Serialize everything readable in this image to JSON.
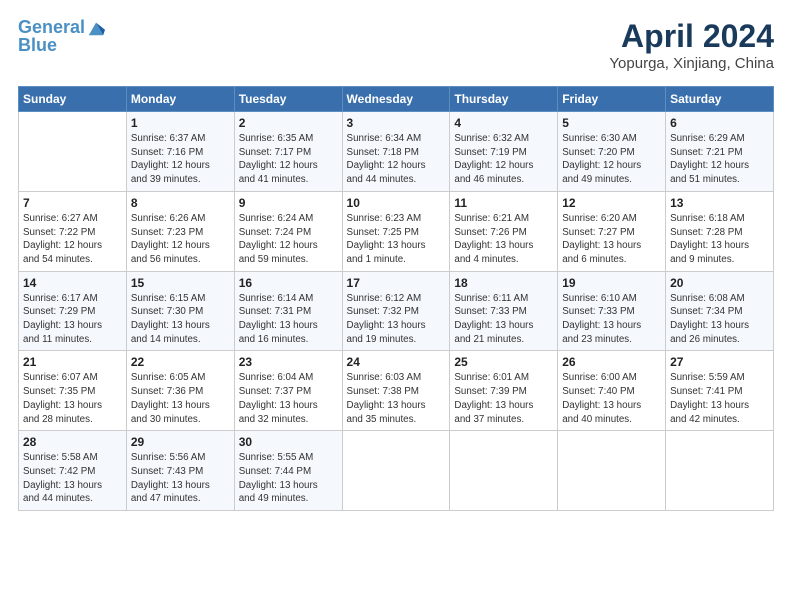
{
  "header": {
    "logo_line1": "General",
    "logo_line2": "Blue",
    "title": "April 2024",
    "subtitle": "Yopurga, Xinjiang, China"
  },
  "columns": [
    "Sunday",
    "Monday",
    "Tuesday",
    "Wednesday",
    "Thursday",
    "Friday",
    "Saturday"
  ],
  "weeks": [
    [
      {
        "day": "",
        "detail": ""
      },
      {
        "day": "1",
        "detail": "Sunrise: 6:37 AM\nSunset: 7:16 PM\nDaylight: 12 hours\nand 39 minutes."
      },
      {
        "day": "2",
        "detail": "Sunrise: 6:35 AM\nSunset: 7:17 PM\nDaylight: 12 hours\nand 41 minutes."
      },
      {
        "day": "3",
        "detail": "Sunrise: 6:34 AM\nSunset: 7:18 PM\nDaylight: 12 hours\nand 44 minutes."
      },
      {
        "day": "4",
        "detail": "Sunrise: 6:32 AM\nSunset: 7:19 PM\nDaylight: 12 hours\nand 46 minutes."
      },
      {
        "day": "5",
        "detail": "Sunrise: 6:30 AM\nSunset: 7:20 PM\nDaylight: 12 hours\nand 49 minutes."
      },
      {
        "day": "6",
        "detail": "Sunrise: 6:29 AM\nSunset: 7:21 PM\nDaylight: 12 hours\nand 51 minutes."
      }
    ],
    [
      {
        "day": "7",
        "detail": "Sunrise: 6:27 AM\nSunset: 7:22 PM\nDaylight: 12 hours\nand 54 minutes."
      },
      {
        "day": "8",
        "detail": "Sunrise: 6:26 AM\nSunset: 7:23 PM\nDaylight: 12 hours\nand 56 minutes."
      },
      {
        "day": "9",
        "detail": "Sunrise: 6:24 AM\nSunset: 7:24 PM\nDaylight: 12 hours\nand 59 minutes."
      },
      {
        "day": "10",
        "detail": "Sunrise: 6:23 AM\nSunset: 7:25 PM\nDaylight: 13 hours\nand 1 minute."
      },
      {
        "day": "11",
        "detail": "Sunrise: 6:21 AM\nSunset: 7:26 PM\nDaylight: 13 hours\nand 4 minutes."
      },
      {
        "day": "12",
        "detail": "Sunrise: 6:20 AM\nSunset: 7:27 PM\nDaylight: 13 hours\nand 6 minutes."
      },
      {
        "day": "13",
        "detail": "Sunrise: 6:18 AM\nSunset: 7:28 PM\nDaylight: 13 hours\nand 9 minutes."
      }
    ],
    [
      {
        "day": "14",
        "detail": "Sunrise: 6:17 AM\nSunset: 7:29 PM\nDaylight: 13 hours\nand 11 minutes."
      },
      {
        "day": "15",
        "detail": "Sunrise: 6:15 AM\nSunset: 7:30 PM\nDaylight: 13 hours\nand 14 minutes."
      },
      {
        "day": "16",
        "detail": "Sunrise: 6:14 AM\nSunset: 7:31 PM\nDaylight: 13 hours\nand 16 minutes."
      },
      {
        "day": "17",
        "detail": "Sunrise: 6:12 AM\nSunset: 7:32 PM\nDaylight: 13 hours\nand 19 minutes."
      },
      {
        "day": "18",
        "detail": "Sunrise: 6:11 AM\nSunset: 7:33 PM\nDaylight: 13 hours\nand 21 minutes."
      },
      {
        "day": "19",
        "detail": "Sunrise: 6:10 AM\nSunset: 7:33 PM\nDaylight: 13 hours\nand 23 minutes."
      },
      {
        "day": "20",
        "detail": "Sunrise: 6:08 AM\nSunset: 7:34 PM\nDaylight: 13 hours\nand 26 minutes."
      }
    ],
    [
      {
        "day": "21",
        "detail": "Sunrise: 6:07 AM\nSunset: 7:35 PM\nDaylight: 13 hours\nand 28 minutes."
      },
      {
        "day": "22",
        "detail": "Sunrise: 6:05 AM\nSunset: 7:36 PM\nDaylight: 13 hours\nand 30 minutes."
      },
      {
        "day": "23",
        "detail": "Sunrise: 6:04 AM\nSunset: 7:37 PM\nDaylight: 13 hours\nand 32 minutes."
      },
      {
        "day": "24",
        "detail": "Sunrise: 6:03 AM\nSunset: 7:38 PM\nDaylight: 13 hours\nand 35 minutes."
      },
      {
        "day": "25",
        "detail": "Sunrise: 6:01 AM\nSunset: 7:39 PM\nDaylight: 13 hours\nand 37 minutes."
      },
      {
        "day": "26",
        "detail": "Sunrise: 6:00 AM\nSunset: 7:40 PM\nDaylight: 13 hours\nand 40 minutes."
      },
      {
        "day": "27",
        "detail": "Sunrise: 5:59 AM\nSunset: 7:41 PM\nDaylight: 13 hours\nand 42 minutes."
      }
    ],
    [
      {
        "day": "28",
        "detail": "Sunrise: 5:58 AM\nSunset: 7:42 PM\nDaylight: 13 hours\nand 44 minutes."
      },
      {
        "day": "29",
        "detail": "Sunrise: 5:56 AM\nSunset: 7:43 PM\nDaylight: 13 hours\nand 47 minutes."
      },
      {
        "day": "30",
        "detail": "Sunrise: 5:55 AM\nSunset: 7:44 PM\nDaylight: 13 hours\nand 49 minutes."
      },
      {
        "day": "",
        "detail": ""
      },
      {
        "day": "",
        "detail": ""
      },
      {
        "day": "",
        "detail": ""
      },
      {
        "day": "",
        "detail": ""
      }
    ]
  ]
}
